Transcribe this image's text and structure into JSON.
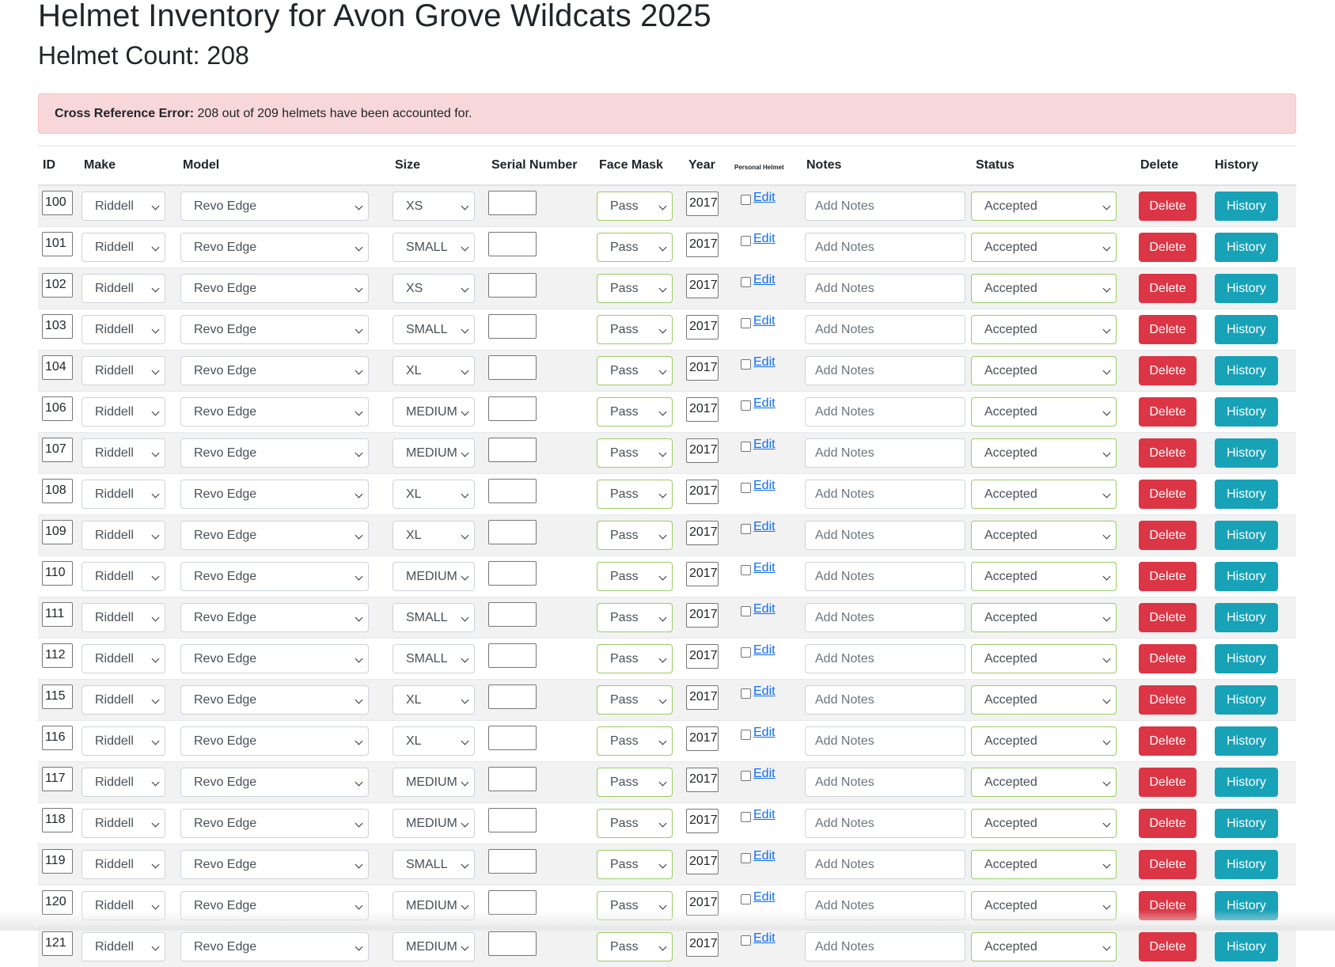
{
  "page": {
    "title": "Helmet Inventory for Avon Grove Wildcats 2025",
    "count_label": "Helmet Count: 208"
  },
  "alert": {
    "label": "Cross Reference Error:",
    "message": "208 out of 209 helmets have been accounted for."
  },
  "table": {
    "headers": {
      "id": "ID",
      "make": "Make",
      "model": "Model",
      "size": "Size",
      "serial": "Serial Number",
      "facemask": "Face Mask",
      "year": "Year",
      "personal": "Personal Helmet",
      "notes": "Notes",
      "status": "Status",
      "delete": "Delete",
      "history": "History"
    },
    "defaults": {
      "make": "Riddell",
      "model": "Revo Edge",
      "facemask": "Pass",
      "year": "2017",
      "edit_label": "Edit",
      "notes_placeholder": "Add Notes",
      "status": "Accepted",
      "delete_label": "Delete",
      "history_label": "History"
    },
    "rows": [
      {
        "id": "100",
        "make": "Riddell",
        "model": "Revo Edge",
        "size": "XS",
        "serial": "",
        "facemask": "Pass",
        "year": "2017",
        "edit": "Edit",
        "notes": "Add Notes",
        "status": "Accepted",
        "delete": "Delete",
        "history": "History"
      },
      {
        "id": "101",
        "make": "Riddell",
        "model": "Revo Edge",
        "size": "SMALL",
        "serial": "",
        "facemask": "Pass",
        "year": "2017",
        "edit": "Edit",
        "notes": "Add Notes",
        "status": "Accepted",
        "delete": "Delete",
        "history": "History"
      },
      {
        "id": "102",
        "make": "Riddell",
        "model": "Revo Edge",
        "size": "XS",
        "serial": "",
        "facemask": "Pass",
        "year": "2017",
        "edit": "Edit",
        "notes": "Add Notes",
        "status": "Accepted",
        "delete": "Delete",
        "history": "History"
      },
      {
        "id": "103",
        "make": "Riddell",
        "model": "Revo Edge",
        "size": "SMALL",
        "serial": "",
        "facemask": "Pass",
        "year": "2017",
        "edit": "Edit",
        "notes": "Add Notes",
        "status": "Accepted",
        "delete": "Delete",
        "history": "History"
      },
      {
        "id": "104",
        "make": "Riddell",
        "model": "Revo Edge",
        "size": "XL",
        "serial": "",
        "facemask": "Pass",
        "year": "2017",
        "edit": "Edit",
        "notes": "Add Notes",
        "status": "Accepted",
        "delete": "Delete",
        "history": "History"
      },
      {
        "id": "106",
        "make": "Riddell",
        "model": "Revo Edge",
        "size": "MEDIUM",
        "serial": "",
        "facemask": "Pass",
        "year": "2017",
        "edit": "Edit",
        "notes": "Add Notes",
        "status": "Accepted",
        "delete": "Delete",
        "history": "History"
      },
      {
        "id": "107",
        "make": "Riddell",
        "model": "Revo Edge",
        "size": "MEDIUM",
        "serial": "",
        "facemask": "Pass",
        "year": "2017",
        "edit": "Edit",
        "notes": "Add Notes",
        "status": "Accepted",
        "delete": "Delete",
        "history": "History"
      },
      {
        "id": "108",
        "make": "Riddell",
        "model": "Revo Edge",
        "size": "XL",
        "serial": "",
        "facemask": "Pass",
        "year": "2017",
        "edit": "Edit",
        "notes": "Add Notes",
        "status": "Accepted",
        "delete": "Delete",
        "history": "History"
      },
      {
        "id": "109",
        "make": "Riddell",
        "model": "Revo Edge",
        "size": "XL",
        "serial": "",
        "facemask": "Pass",
        "year": "2017",
        "edit": "Edit",
        "notes": "Add Notes",
        "status": "Accepted",
        "delete": "Delete",
        "history": "History"
      },
      {
        "id": "110",
        "make": "Riddell",
        "model": "Revo Edge",
        "size": "MEDIUM",
        "serial": "",
        "facemask": "Pass",
        "year": "2017",
        "edit": "Edit",
        "notes": "Add Notes",
        "status": "Accepted",
        "delete": "Delete",
        "history": "History"
      },
      {
        "id": "111",
        "make": "Riddell",
        "model": "Revo Edge",
        "size": "SMALL",
        "serial": "",
        "facemask": "Pass",
        "year": "2017",
        "edit": "Edit",
        "notes": "Add Notes",
        "status": "Accepted",
        "delete": "Delete",
        "history": "History"
      },
      {
        "id": "112",
        "make": "Riddell",
        "model": "Revo Edge",
        "size": "SMALL",
        "serial": "",
        "facemask": "Pass",
        "year": "2017",
        "edit": "Edit",
        "notes": "Add Notes",
        "status": "Accepted",
        "delete": "Delete",
        "history": "History"
      },
      {
        "id": "115",
        "make": "Riddell",
        "model": "Revo Edge",
        "size": "XL",
        "serial": "",
        "facemask": "Pass",
        "year": "2017",
        "edit": "Edit",
        "notes": "Add Notes",
        "status": "Accepted",
        "delete": "Delete",
        "history": "History"
      },
      {
        "id": "116",
        "make": "Riddell",
        "model": "Revo Edge",
        "size": "XL",
        "serial": "",
        "facemask": "Pass",
        "year": "2017",
        "edit": "Edit",
        "notes": "Add Notes",
        "status": "Accepted",
        "delete": "Delete",
        "history": "History"
      },
      {
        "id": "117",
        "make": "Riddell",
        "model": "Revo Edge",
        "size": "MEDIUM",
        "serial": "",
        "facemask": "Pass",
        "year": "2017",
        "edit": "Edit",
        "notes": "Add Notes",
        "status": "Accepted",
        "delete": "Delete",
        "history": "History"
      },
      {
        "id": "118",
        "make": "Riddell",
        "model": "Revo Edge",
        "size": "MEDIUM",
        "serial": "",
        "facemask": "Pass",
        "year": "2017",
        "edit": "Edit",
        "notes": "Add Notes",
        "status": "Accepted",
        "delete": "Delete",
        "history": "History"
      },
      {
        "id": "119",
        "make": "Riddell",
        "model": "Revo Edge",
        "size": "SMALL",
        "serial": "",
        "facemask": "Pass",
        "year": "2017",
        "edit": "Edit",
        "notes": "Add Notes",
        "status": "Accepted",
        "delete": "Delete",
        "history": "History"
      },
      {
        "id": "120",
        "make": "Riddell",
        "model": "Revo Edge",
        "size": "MEDIUM",
        "serial": "",
        "facemask": "Pass",
        "year": "2017",
        "edit": "Edit",
        "notes": "Add Notes",
        "status": "Accepted",
        "delete": "Delete",
        "history": "History"
      },
      {
        "id": "121",
        "make": "Riddell",
        "model": "Revo Edge",
        "size": "MEDIUM",
        "serial": "",
        "facemask": "Pass",
        "year": "2017",
        "edit": "Edit",
        "notes": "Add Notes",
        "status": "Accepted",
        "delete": "Delete",
        "history": "History"
      }
    ]
  },
  "colors": {
    "alert_bg": "#f8d7da",
    "delete": "#dc3545",
    "history": "#17a2b8",
    "link": "#0d6efd",
    "valid_border": "#9ccc65"
  }
}
